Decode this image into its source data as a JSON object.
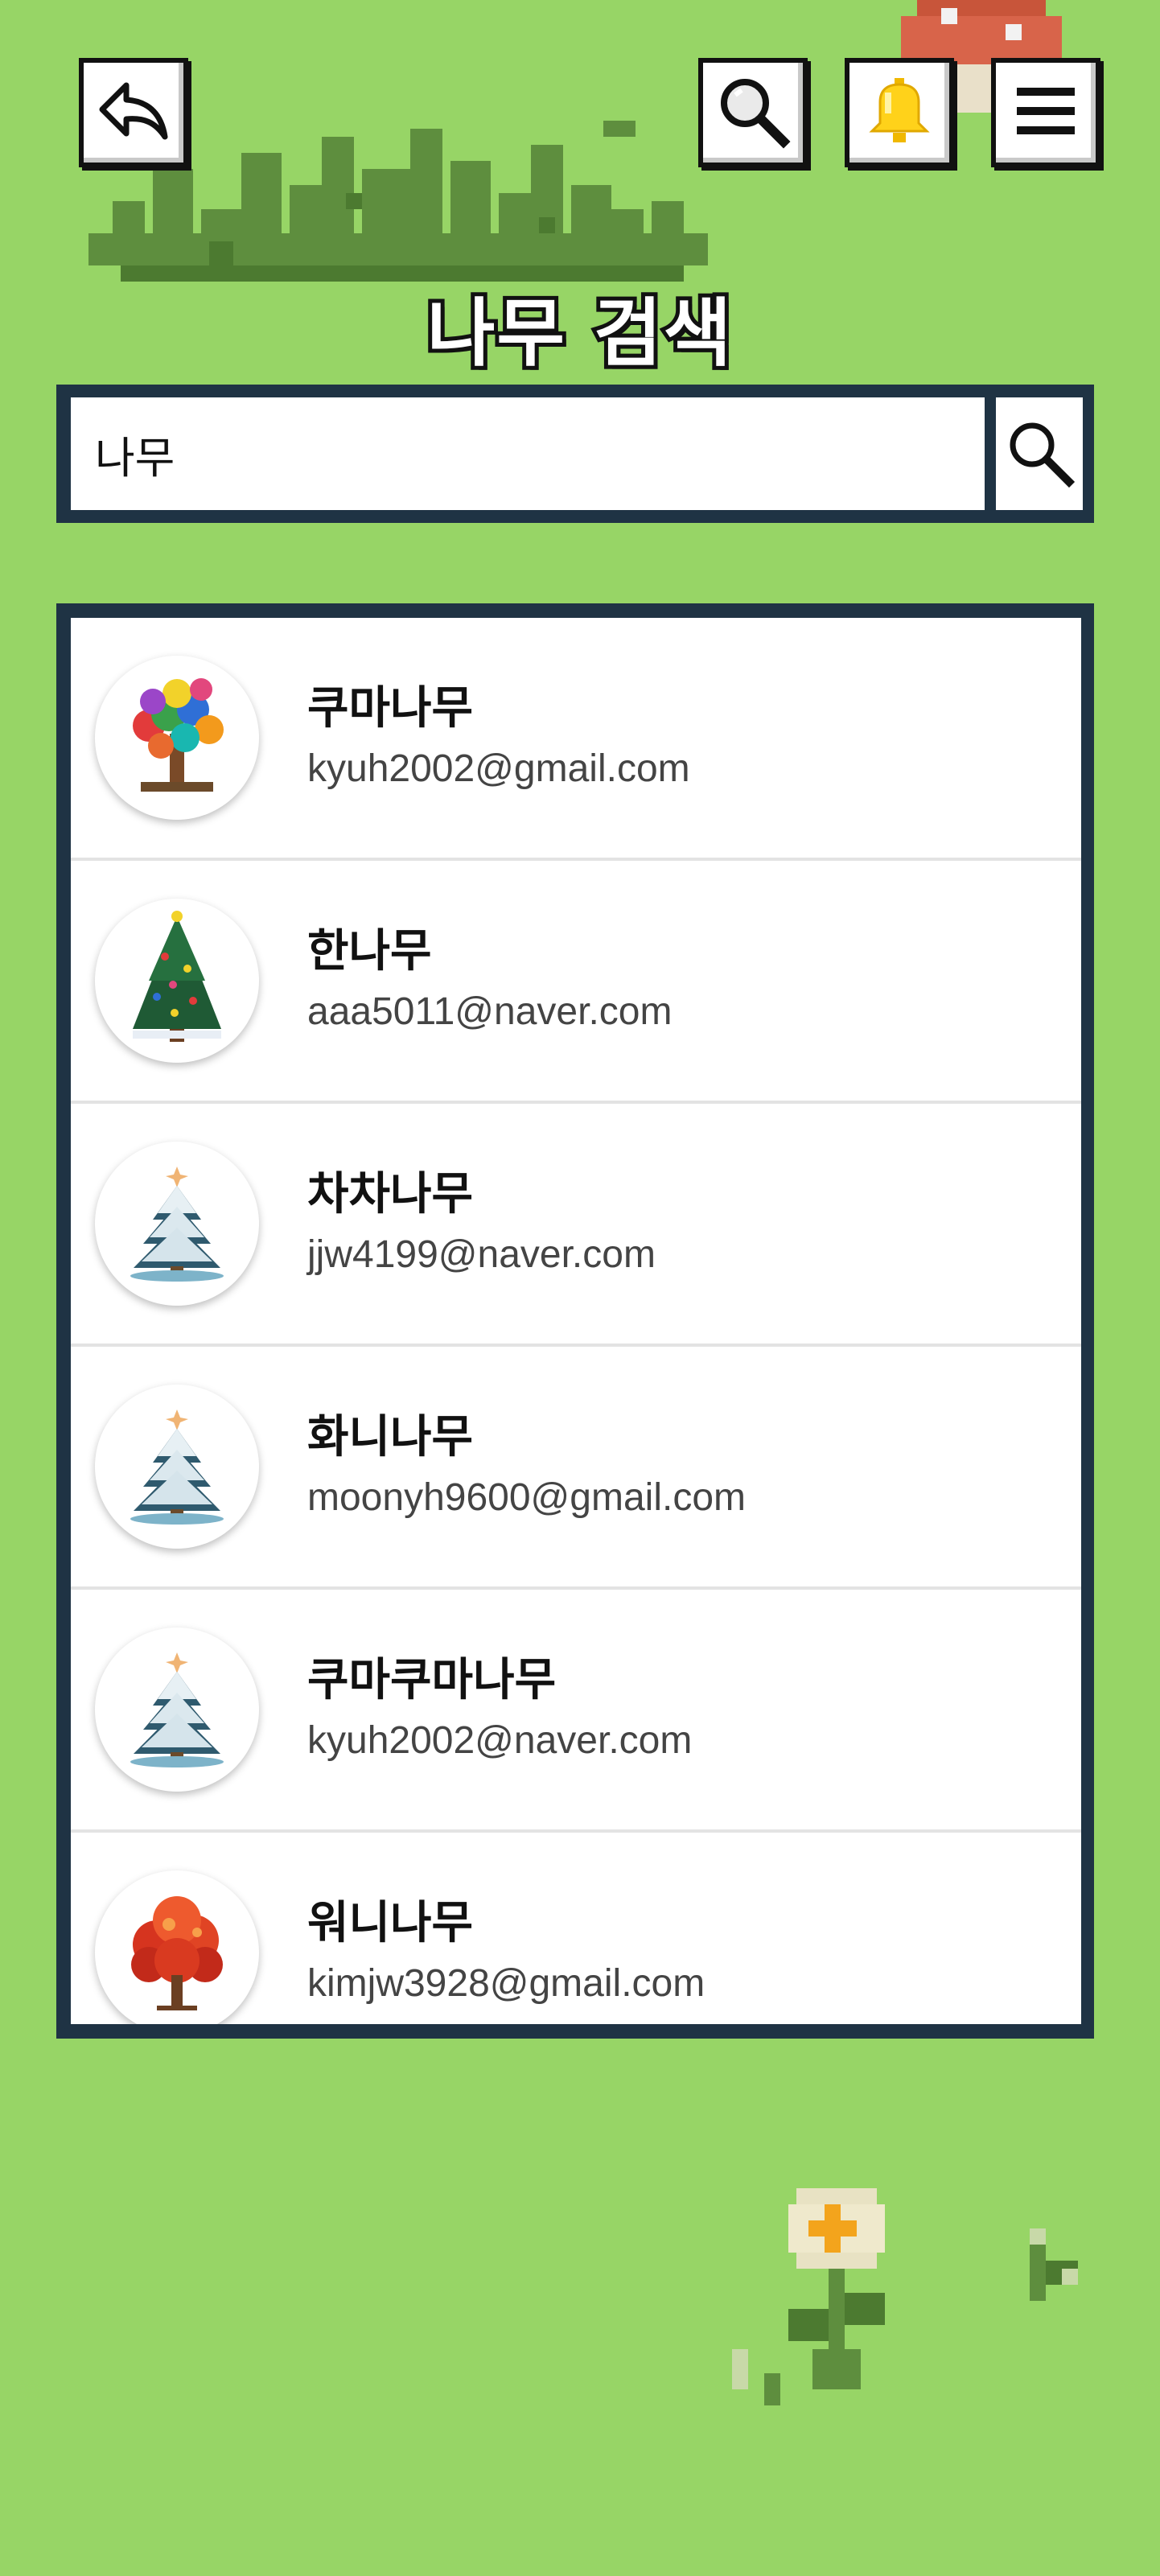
{
  "header": {
    "title": "나무 검색",
    "back_icon": "back-arrow-icon",
    "search_icon": "magnifier-icon",
    "bell_icon": "bell-icon",
    "menu_icon": "hamburger-menu-icon"
  },
  "search": {
    "value": "나무",
    "submit_icon": "magnifier-icon"
  },
  "results": [
    {
      "name": "쿠마나무",
      "email": "kyuh2002@gmail.com",
      "avatar": "rainbow-balloon-tree"
    },
    {
      "name": "한나무",
      "email": "aaa5011@naver.com",
      "avatar": "christmas-tree"
    },
    {
      "name": "차차나무",
      "email": "jjw4199@naver.com",
      "avatar": "snowy-pine-tree"
    },
    {
      "name": "화니나무",
      "email": "moonyh9600@gmail.com",
      "avatar": "snowy-pine-tree"
    },
    {
      "name": "쿠마쿠마나무",
      "email": "kyuh2002@naver.com",
      "avatar": "snowy-pine-tree"
    },
    {
      "name": "워니나무",
      "email": "kimjw3928@gmail.com",
      "avatar": "red-autumn-tree"
    }
  ],
  "colors": {
    "background": "#97d566",
    "panel_border": "#1f3344",
    "bell": "#ffd21a"
  }
}
